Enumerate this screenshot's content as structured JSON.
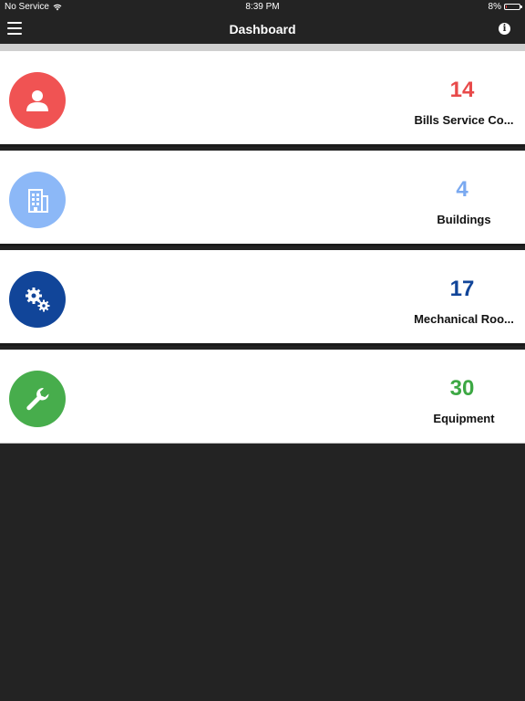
{
  "status_bar": {
    "carrier": "No Service",
    "time": "8:39 PM",
    "battery": "8%",
    "battery_level": 0.08
  },
  "nav": {
    "title": "Dashboard",
    "menu_icon": "hamburger-menu-icon",
    "info_icon": "info-icon"
  },
  "cards": [
    {
      "count": "14",
      "label": "Bills Service Co...",
      "icon": "user-icon",
      "color": "#f05353",
      "count_color": "#e84a4a"
    },
    {
      "count": "4",
      "label": "Buildings",
      "icon": "building-icon",
      "color": "#8cb8f7",
      "count_color": "#7aa9f0"
    },
    {
      "count": "17",
      "label": "Mechanical Roo...",
      "icon": "gears-icon",
      "color": "#114599",
      "count_color": "#114599"
    },
    {
      "count": "30",
      "label": "Equipment",
      "icon": "wrench-icon",
      "color": "#47ad4c",
      "count_color": "#3da844"
    }
  ]
}
